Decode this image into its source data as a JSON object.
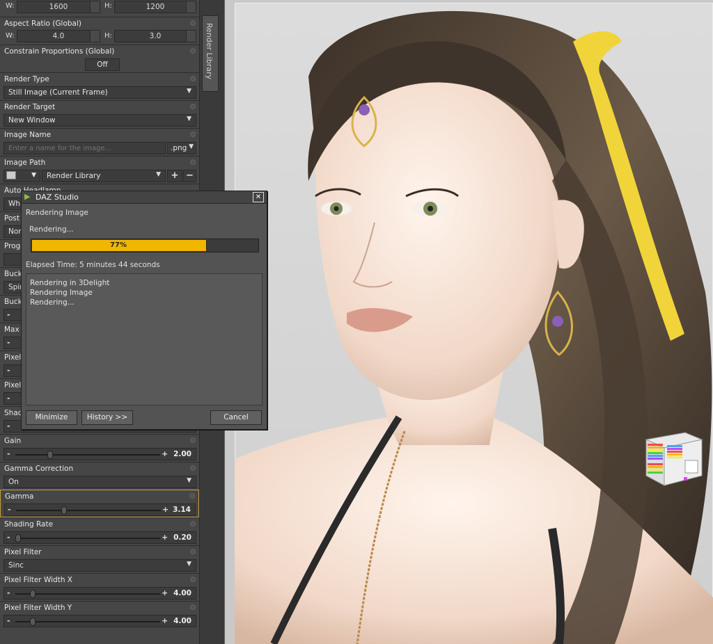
{
  "panel": {
    "dims": {
      "w_label": "W:",
      "w_value": "1600",
      "h_label": "H:",
      "h_value": "1200"
    },
    "aspect": {
      "label": "Aspect Ratio (Global)",
      "w_label": "W:",
      "w_value": "4.0",
      "h_label": "H:",
      "h_value": "3.0"
    },
    "constrain": {
      "label": "Constrain Proportions (Global)",
      "value": "Off"
    },
    "render_type": {
      "label": "Render Type",
      "value": "Still Image (Current Frame)"
    },
    "render_target": {
      "label": "Render Target",
      "value": "New Window"
    },
    "image_name": {
      "label": "Image Name",
      "placeholder": "Enter a name for the image...",
      "ext": ".png"
    },
    "image_path": {
      "label": "Image Path",
      "value": "Render Library"
    },
    "partial": {
      "auto": "Auto Headlamp",
      "auto_val": "Wh",
      "post": "Post",
      "post_val": "Non",
      "prog": "Prog",
      "buck1": "Buck",
      "buck1_val": "Spir",
      "buck2": "Buck",
      "max": "Max",
      "pix1": "Pixel",
      "pix2": "Pixel",
      "shad": "Shad"
    },
    "gain": {
      "label": "Gain",
      "value": "2.00",
      "pos": 0.24
    },
    "gamma_correction": {
      "label": "Gamma Correction",
      "value": "On"
    },
    "gamma": {
      "label": "Gamma",
      "value": "3.14",
      "pos": 0.33
    },
    "shading_rate": {
      "label": "Shading Rate",
      "value": "0.20",
      "pos": 0.02
    },
    "pixel_filter": {
      "label": "Pixel Filter",
      "value": "Sinc"
    },
    "pfw_x": {
      "label": "Pixel Filter Width X",
      "value": "4.00",
      "pos": 0.12
    },
    "pfw_y": {
      "label": "Pixel Filter Width Y",
      "value": "4.00",
      "pos": 0.12
    }
  },
  "side_tab": {
    "label": "Render Library"
  },
  "dialog": {
    "title": "DAZ Studio",
    "header": "Rendering Image",
    "status": "Rendering...",
    "progress_percent": 77,
    "progress_label": "77%",
    "elapsed": "Elapsed Time:  5 minutes 44 seconds",
    "log": [
      "Rendering in 3Delight",
      "Rendering Image",
      "Rendering..."
    ],
    "buttons": {
      "minimize": "Minimize",
      "history": "History >>",
      "cancel": "Cancel"
    }
  },
  "colors": {
    "progress": "#f2b600",
    "highlight": "#c8a13a",
    "panel": "#464646"
  }
}
